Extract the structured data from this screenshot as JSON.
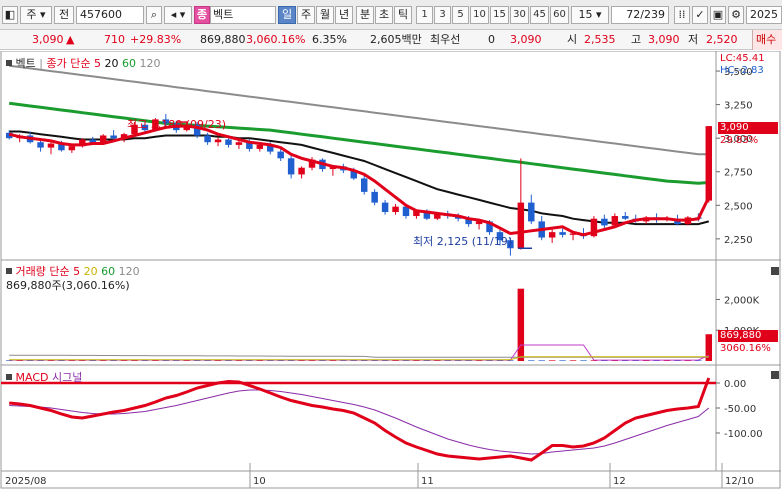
{
  "toolbar": {
    "mode": "주",
    "market": "전",
    "code": "457600",
    "name_badge": "종",
    "name": "벡트",
    "periods": [
      "일",
      "주",
      "월",
      "년",
      "분",
      "초",
      "틱"
    ],
    "intervals": [
      "1",
      "3",
      "5",
      "10",
      "15",
      "30",
      "45",
      "60"
    ],
    "count": "15",
    "page": "72/239",
    "date": "2025"
  },
  "info": {
    "price": "3,090",
    "change": "710",
    "change_pct": "+29.83%",
    "volume": "869,880",
    "volume_pct": "3,060.16%",
    "turnover": "6.35%",
    "amount": "2,605백만",
    "pref_label": "최우선",
    "pref_value": "0",
    "pref_price": "3,090",
    "open_label": "시",
    "open": "2,535",
    "high_label": "고",
    "high": "3,090",
    "low_label": "저",
    "low": "2,520",
    "trade_btn": "매수"
  },
  "price_pane": {
    "legend_name": "벡트",
    "legend_ma": "종가 단순",
    "ma_periods": [
      "5",
      "20",
      "60",
      "120"
    ],
    "lc": "LC:45.41",
    "hc": "HC:-2.83",
    "price_tag": "3,090",
    "pct_tag": "29.83%",
    "high_note": "최고 3,180 (09/23)",
    "low_note": "최저 2,125 (11/19)",
    "y_ticks": [
      "3,500",
      "3,250",
      "3,000",
      "2,750",
      "2,500",
      "2,250"
    ]
  },
  "volume_pane": {
    "legend": "거래량 단순",
    "ma_periods": [
      "5",
      "20",
      "60",
      "120"
    ],
    "sub": "869,880주(3,060.16%)",
    "y_ticks": [
      "2,000K",
      "1,000K"
    ],
    "vol_tag": "869,880",
    "pct_tag": "3060.16%"
  },
  "macd_pane": {
    "legend_macd": "MACD",
    "legend_signal": "시그널",
    "y_ticks": [
      "0.00",
      "-50.00",
      "-100.00"
    ]
  },
  "x_axis": {
    "labels": [
      "2025/08",
      "10",
      "11",
      "12",
      "12/10"
    ]
  },
  "colors": {
    "up": "#e0001a",
    "down": "#1f5fd0",
    "ma5": "#e0001a",
    "ma20": "#111111",
    "ma60": "#1a9c2e",
    "ma120": "#8c8c8c",
    "signal": "#8a2ba8"
  },
  "chart_data": {
    "type": "candlestick",
    "price_pane": {
      "ylim": [
        2100,
        3560
      ],
      "candles": [
        {
          "o": 3040,
          "h": 3060,
          "l": 2990,
          "c": 3000
        },
        {
          "o": 3000,
          "h": 3030,
          "l": 2970,
          "c": 3020
        },
        {
          "o": 3020,
          "h": 3050,
          "l": 2960,
          "c": 2970
        },
        {
          "o": 2970,
          "h": 3000,
          "l": 2900,
          "c": 2930
        },
        {
          "o": 2930,
          "h": 2980,
          "l": 2880,
          "c": 2960
        },
        {
          "o": 2960,
          "h": 2980,
          "l": 2900,
          "c": 2910
        },
        {
          "o": 2910,
          "h": 2950,
          "l": 2890,
          "c": 2940
        },
        {
          "o": 2940,
          "h": 3000,
          "l": 2930,
          "c": 2990
        },
        {
          "o": 2990,
          "h": 3010,
          "l": 2950,
          "c": 2960
        },
        {
          "o": 2960,
          "h": 3030,
          "l": 2950,
          "c": 3020
        },
        {
          "o": 3020,
          "h": 3060,
          "l": 2990,
          "c": 3000
        },
        {
          "o": 3000,
          "h": 3040,
          "l": 2970,
          "c": 3030
        },
        {
          "o": 3030,
          "h": 3120,
          "l": 3020,
          "c": 3100
        },
        {
          "o": 3100,
          "h": 3130,
          "l": 3040,
          "c": 3060
        },
        {
          "o": 3060,
          "h": 3150,
          "l": 3050,
          "c": 3140
        },
        {
          "o": 3140,
          "h": 3180,
          "l": 3090,
          "c": 3110
        },
        {
          "o": 3110,
          "h": 3130,
          "l": 3040,
          "c": 3060
        },
        {
          "o": 3060,
          "h": 3120,
          "l": 3050,
          "c": 3100
        },
        {
          "o": 3100,
          "h": 3120,
          "l": 3000,
          "c": 3020
        },
        {
          "o": 3020,
          "h": 3040,
          "l": 2950,
          "c": 2970
        },
        {
          "o": 2970,
          "h": 3010,
          "l": 2940,
          "c": 2990
        },
        {
          "o": 2990,
          "h": 3000,
          "l": 2930,
          "c": 2950
        },
        {
          "o": 2950,
          "h": 2990,
          "l": 2920,
          "c": 2970
        },
        {
          "o": 2970,
          "h": 2990,
          "l": 2900,
          "c": 2920
        },
        {
          "o": 2920,
          "h": 2960,
          "l": 2900,
          "c": 2950
        },
        {
          "o": 2950,
          "h": 2970,
          "l": 2880,
          "c": 2900
        },
        {
          "o": 2900,
          "h": 2920,
          "l": 2830,
          "c": 2850
        },
        {
          "o": 2850,
          "h": 2870,
          "l": 2700,
          "c": 2730
        },
        {
          "o": 2730,
          "h": 2790,
          "l": 2700,
          "c": 2780
        },
        {
          "o": 2780,
          "h": 2860,
          "l": 2760,
          "c": 2840
        },
        {
          "o": 2840,
          "h": 2850,
          "l": 2750,
          "c": 2770
        },
        {
          "o": 2770,
          "h": 2800,
          "l": 2720,
          "c": 2790
        },
        {
          "o": 2790,
          "h": 2810,
          "l": 2740,
          "c": 2760
        },
        {
          "o": 2760,
          "h": 2780,
          "l": 2690,
          "c": 2700
        },
        {
          "o": 2700,
          "h": 2720,
          "l": 2580,
          "c": 2600
        },
        {
          "o": 2600,
          "h": 2620,
          "l": 2500,
          "c": 2520
        },
        {
          "o": 2520,
          "h": 2540,
          "l": 2430,
          "c": 2450
        },
        {
          "o": 2450,
          "h": 2510,
          "l": 2430,
          "c": 2490
        },
        {
          "o": 2490,
          "h": 2500,
          "l": 2400,
          "c": 2420
        },
        {
          "o": 2420,
          "h": 2470,
          "l": 2400,
          "c": 2460
        },
        {
          "o": 2460,
          "h": 2470,
          "l": 2390,
          "c": 2400
        },
        {
          "o": 2400,
          "h": 2450,
          "l": 2390,
          "c": 2440
        },
        {
          "o": 2440,
          "h": 2460,
          "l": 2400,
          "c": 2420
        },
        {
          "o": 2420,
          "h": 2440,
          "l": 2380,
          "c": 2400
        },
        {
          "o": 2400,
          "h": 2420,
          "l": 2340,
          "c": 2360
        },
        {
          "o": 2360,
          "h": 2400,
          "l": 2320,
          "c": 2380
        },
        {
          "o": 2380,
          "h": 2390,
          "l": 2280,
          "c": 2300
        },
        {
          "o": 2300,
          "h": 2320,
          "l": 2200,
          "c": 2240
        },
        {
          "o": 2240,
          "h": 2260,
          "l": 2125,
          "c": 2180
        },
        {
          "o": 2180,
          "h": 2850,
          "l": 2170,
          "c": 2520
        },
        {
          "o": 2520,
          "h": 2580,
          "l": 2360,
          "c": 2380
        },
        {
          "o": 2380,
          "h": 2420,
          "l": 2240,
          "c": 2260
        },
        {
          "o": 2260,
          "h": 2320,
          "l": 2220,
          "c": 2300
        },
        {
          "o": 2300,
          "h": 2340,
          "l": 2260,
          "c": 2280
        },
        {
          "o": 2280,
          "h": 2300,
          "l": 2240,
          "c": 2290
        },
        {
          "o": 2290,
          "h": 2330,
          "l": 2250,
          "c": 2270
        },
        {
          "o": 2270,
          "h": 2420,
          "l": 2260,
          "c": 2400
        },
        {
          "o": 2400,
          "h": 2430,
          "l": 2330,
          "c": 2350
        },
        {
          "o": 2350,
          "h": 2440,
          "l": 2340,
          "c": 2420
        },
        {
          "o": 2420,
          "h": 2450,
          "l": 2390,
          "c": 2400
        },
        {
          "o": 2400,
          "h": 2430,
          "l": 2370,
          "c": 2380
        },
        {
          "o": 2380,
          "h": 2420,
          "l": 2360,
          "c": 2410
        },
        {
          "o": 2410,
          "h": 2440,
          "l": 2370,
          "c": 2390
        },
        {
          "o": 2390,
          "h": 2420,
          "l": 2380,
          "c": 2400
        },
        {
          "o": 2400,
          "h": 2430,
          "l": 2350,
          "c": 2360
        },
        {
          "o": 2360,
          "h": 2420,
          "l": 2350,
          "c": 2410
        },
        {
          "o": 2410,
          "h": 2440,
          "l": 2380,
          "c": 2400
        },
        {
          "o": 2535,
          "h": 3090,
          "l": 2520,
          "c": 3090
        }
      ],
      "ma5": [
        3030,
        3010,
        3000,
        2990,
        2980,
        2960,
        2950,
        2950,
        2960,
        2960,
        2980,
        3000,
        3020,
        3040,
        3060,
        3080,
        3090,
        3090,
        3080,
        3060,
        3030,
        3010,
        2990,
        2970,
        2960,
        2950,
        2930,
        2880,
        2850,
        2830,
        2810,
        2790,
        2780,
        2760,
        2730,
        2680,
        2620,
        2560,
        2500,
        2460,
        2450,
        2440,
        2430,
        2420,
        2400,
        2390,
        2370,
        2330,
        2290,
        2300,
        2310,
        2320,
        2330,
        2340,
        2300,
        2280,
        2300,
        2320,
        2340,
        2370,
        2390,
        2400,
        2400,
        2400,
        2390,
        2390,
        2400,
        2560
      ],
      "ma20": [
        3050,
        3050,
        3040,
        3030,
        3020,
        3010,
        3000,
        2990,
        2990,
        2990,
        2990,
        2990,
        3000,
        3000,
        3010,
        3020,
        3020,
        3020,
        3020,
        3020,
        3010,
        3010,
        3000,
        3000,
        2990,
        2980,
        2970,
        2960,
        2950,
        2930,
        2910,
        2890,
        2870,
        2850,
        2830,
        2800,
        2770,
        2740,
        2710,
        2680,
        2650,
        2620,
        2600,
        2580,
        2560,
        2540,
        2520,
        2500,
        2480,
        2470,
        2460,
        2440,
        2430,
        2420,
        2400,
        2390,
        2380,
        2370,
        2370,
        2370,
        2360,
        2360,
        2360,
        2360,
        2360,
        2360,
        2360,
        2380
      ],
      "ma60": [
        3260,
        3250,
        3240,
        3230,
        3220,
        3210,
        3200,
        3190,
        3180,
        3170,
        3160,
        3150,
        3140,
        3130,
        3120,
        3110,
        3105,
        3100,
        3095,
        3090,
        3085,
        3080,
        3075,
        3070,
        3065,
        3060,
        3050,
        3040,
        3030,
        3020,
        3010,
        3000,
        2990,
        2980,
        2970,
        2960,
        2950,
        2940,
        2930,
        2920,
        2910,
        2900,
        2890,
        2880,
        2870,
        2860,
        2850,
        2840,
        2830,
        2820,
        2810,
        2800,
        2790,
        2780,
        2770,
        2760,
        2750,
        2740,
        2730,
        2720,
        2710,
        2700,
        2690,
        2680,
        2675,
        2670,
        2665,
        2670
      ],
      "ma120": [
        3540,
        3530,
        3520,
        3510,
        3500,
        3490,
        3480,
        3470,
        3460,
        3450,
        3440,
        3430,
        3420,
        3410,
        3400,
        3390,
        3380,
        3370,
        3360,
        3350,
        3340,
        3330,
        3320,
        3310,
        3300,
        3290,
        3280,
        3270,
        3260,
        3250,
        3240,
        3230,
        3220,
        3210,
        3200,
        3190,
        3180,
        3170,
        3160,
        3150,
        3140,
        3130,
        3120,
        3110,
        3100,
        3090,
        3080,
        3070,
        3060,
        3050,
        3040,
        3030,
        3020,
        3010,
        3000,
        2990,
        2980,
        2970,
        2960,
        2950,
        2940,
        2930,
        2920,
        2910,
        2900,
        2890,
        2880,
        2880
      ]
    },
    "volume_pane": {
      "ylim": [
        0,
        2600
      ],
      "unit": "K",
      "spikes": [
        {
          "index": 49,
          "value": 2350
        },
        {
          "index": 67,
          "value": 870
        }
      ],
      "base": 20
    },
    "macd_pane": {
      "ylim": [
        -160,
        20
      ],
      "macd": [
        -40,
        -42,
        -45,
        -50,
        -55,
        -62,
        -68,
        -70,
        -66,
        -62,
        -58,
        -55,
        -50,
        -45,
        -38,
        -30,
        -25,
        -18,
        -10,
        -5,
        0,
        3,
        2,
        -5,
        -12,
        -20,
        -28,
        -35,
        -40,
        -45,
        -48,
        -52,
        -55,
        -60,
        -70,
        -80,
        -95,
        -108,
        -120,
        -128,
        -135,
        -142,
        -146,
        -148,
        -150,
        -152,
        -150,
        -148,
        -146,
        -150,
        -154,
        -140,
        -125,
        -125,
        -128,
        -126,
        -120,
        -110,
        -95,
        -80,
        -70,
        -65,
        -60,
        -55,
        -52,
        -50,
        -47,
        10
      ],
      "signal": [
        -45,
        -46,
        -47,
        -48,
        -50,
        -53,
        -56,
        -59,
        -61,
        -62,
        -62,
        -61,
        -59,
        -57,
        -53,
        -49,
        -45,
        -40,
        -35,
        -30,
        -25,
        -20,
        -16,
        -14,
        -14,
        -15,
        -17,
        -20,
        -23,
        -27,
        -31,
        -35,
        -39,
        -43,
        -48,
        -54,
        -62,
        -70,
        -79,
        -88,
        -96,
        -104,
        -112,
        -118,
        -124,
        -129,
        -133,
        -136,
        -138,
        -140,
        -142,
        -141,
        -138,
        -136,
        -134,
        -132,
        -130,
        -126,
        -120,
        -113,
        -106,
        -99,
        -92,
        -85,
        -79,
        -73,
        -67,
        -50
      ]
    }
  }
}
